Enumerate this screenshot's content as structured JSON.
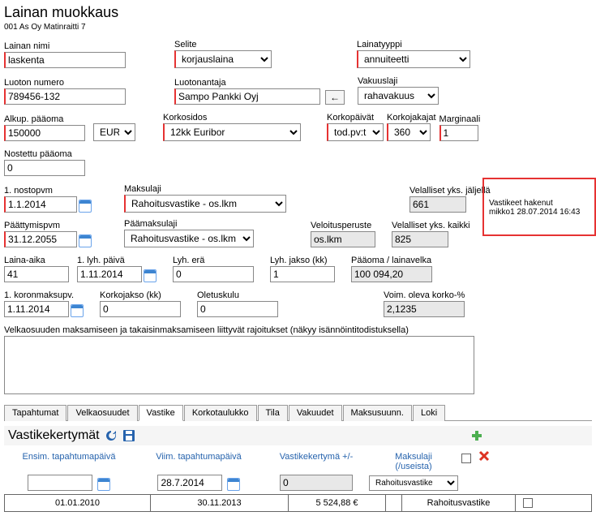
{
  "header": {
    "title": "Lainan muokkaus",
    "subtitle": "001 As Oy Matinraitti 7"
  },
  "row1": {
    "name_label": "Lainan nimi",
    "name_value": "laskenta",
    "selite_label": "Selite",
    "selite_value": "korjauslaina",
    "lainatyyppi_label": "Lainatyyppi",
    "lainatyyppi_value": "annuiteetti"
  },
  "row2": {
    "numero_label": "Luoton numero",
    "numero_value": "789456-132",
    "antaja_label": "Luotonantaja",
    "antaja_value": "Sampo Pankki Oyj",
    "vakuus_label": "Vakuuslaji",
    "vakuus_value": "rahavakuus"
  },
  "row3": {
    "paaoma_label": "Alkup. pääoma",
    "paaoma_value": "150000",
    "currency": "EUR",
    "korkosidos_label": "Korkosidos",
    "korkosidos_value": "12kk Euribor",
    "korkopaivat_label": "Korkopäivät",
    "korkopaivat_value": "tod.pv:t",
    "korkojakajat_label": "Korkojakajat",
    "korkojakajat_value": "360",
    "marginaali_label": "Marginaali",
    "marginaali_value": "1"
  },
  "row4": {
    "nostettu_label": "Nostettu pääoma",
    "nostettu_value": "0"
  },
  "row5": {
    "nostopvm_label": "1. nostopvm",
    "nostopvm_value": "1.1.2014",
    "maksulaji_label": "Maksulaji",
    "maksulaji_value": "Rahoitusvastike - os.lkm",
    "jaljella_label": "Velalliset yks. jäljellä",
    "jaljella_value": "661",
    "hakenut_label": "Vastikeet hakenut",
    "hakenut_value": "mikko1 28.07.2014 16:43"
  },
  "row6": {
    "paatty_label": "Päättymispvm",
    "paatty_value": "31.12.2055",
    "paamaks_label": "Päämaksulaji",
    "paamaks_value": "Rahoitusvastike - os.lkm",
    "veloitus_label": "Veloitusperuste",
    "veloitus_value": "os.lkm",
    "kaikki_label": "Velalliset yks. kaikki",
    "kaikki_value": "825"
  },
  "row7": {
    "lainaaika_label": "Laina-aika",
    "lainaaika_value": "41",
    "lyhpaiva_label": "1. lyh. päivä",
    "lyhpaiva_value": "1.11.2014",
    "lyhera_label": "Lyh. erä",
    "lyhera_value": "0",
    "lyhjakso_label": "Lyh. jakso (kk)",
    "lyhjakso_value": "1",
    "paaomavelka_label": "Pääoma / lainavelka",
    "paaomavelka_value": "100 094,20"
  },
  "row8": {
    "koronmaksu_label": "1. koronmaksupv.",
    "koronmaksu_value": "1.11.2014",
    "korkijakso_label": "Korkojakso (kk)",
    "korkijakso_value": "0",
    "oletuskulu_label": "Oletuskulu",
    "oletuskulu_value": "0",
    "voimkorko_label": "Voim. oleva korko-%",
    "voimkorko_value": "2,1235"
  },
  "textarea_label": "Velkaosuuden maksamiseen ja takaisinmaksamiseen liittyvät rajoitukset (näkyy isännöintitodistuksella)",
  "tabs": {
    "t0": "Tapahtumat",
    "t1": "Velkaosuudet",
    "t2": "Vastike",
    "t3": "Korkotaulukko",
    "t4": "Tila",
    "t5": "Vakuudet",
    "t6": "Maksusuunn.",
    "t7": "Loki"
  },
  "section_title": "Vastikekertymät",
  "cols": {
    "c0": "Ensim. tapahtumapäivä",
    "c1": "Viim. tapahtumapäivä",
    "c2": "Vastikekertymä +/-",
    "c3a": "Maksulaji",
    "c3b": "(/useista)"
  },
  "inputs": {
    "ensim": "",
    "viim": "28.7.2014",
    "kertyma": "0",
    "maksulaji": "Rahoitusvastike"
  },
  "datarow": {
    "d0": "01.01.2010",
    "d1": "30.11.2013",
    "d2": "5 524,88 €",
    "d3": "Rahoitusvastike"
  }
}
